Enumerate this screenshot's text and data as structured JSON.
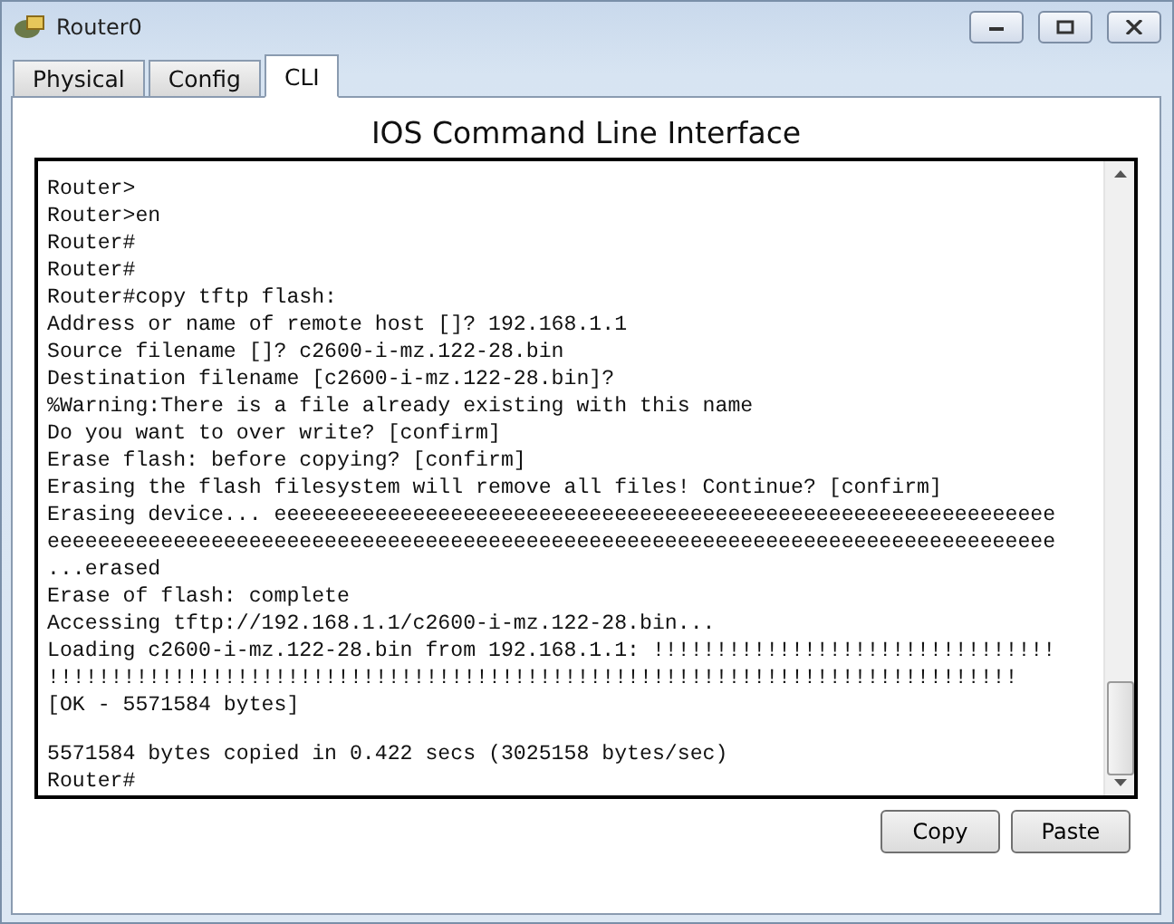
{
  "window": {
    "title": "Router0"
  },
  "tabs": [
    {
      "label": "Physical",
      "selected": false
    },
    {
      "label": "Config",
      "selected": false
    },
    {
      "label": "CLI",
      "selected": true
    }
  ],
  "heading": "IOS Command Line Interface",
  "terminal_lines": [
    "Router>",
    "Router>en",
    "Router#",
    "Router#",
    "Router#copy tftp flash:",
    "Address or name of remote host []? 192.168.1.1",
    "Source filename []? c2600-i-mz.122-28.bin",
    "Destination filename [c2600-i-mz.122-28.bin]?",
    "%Warning:There is a file already existing with this name",
    "Do you want to over write? [confirm]",
    "Erase flash: before copying? [confirm]",
    "Erasing the flash filesystem will remove all files! Continue? [confirm]",
    "Erasing device... eeeeeeeeeeeeeeeeeeeeeeeeeeeeeeeeeeeeeeeeeeeeeeeeeeeeeeeeeeeeee",
    "eeeeeeeeeeeeeeeeeeeeeeeeeeeeeeeeeeeeeeeeeeeeeeeeeeeeeeeeeeeeeeeeeeeeeeeeeeeeeeee",
    "...erased",
    "Erase of flash: complete",
    "Accessing tftp://192.168.1.1/c2600-i-mz.122-28.bin...",
    "Loading c2600-i-mz.122-28.bin from 192.168.1.1: !!!!!!!!!!!!!!!!!!!!!!!!!!!!!!!!",
    "!!!!!!!!!!!!!!!!!!!!!!!!!!!!!!!!!!!!!!!!!!!!!!!!!!!!!!!!!!!!!!!!!!!!!!!!!!!!!",
    "[OK - 5571584 bytes]",
    {
      "kind": "blank"
    },
    "5571584 bytes copied in 0.422 secs (3025158 bytes/sec)",
    "Router#"
  ],
  "buttons": [
    "Copy",
    "Paste"
  ]
}
